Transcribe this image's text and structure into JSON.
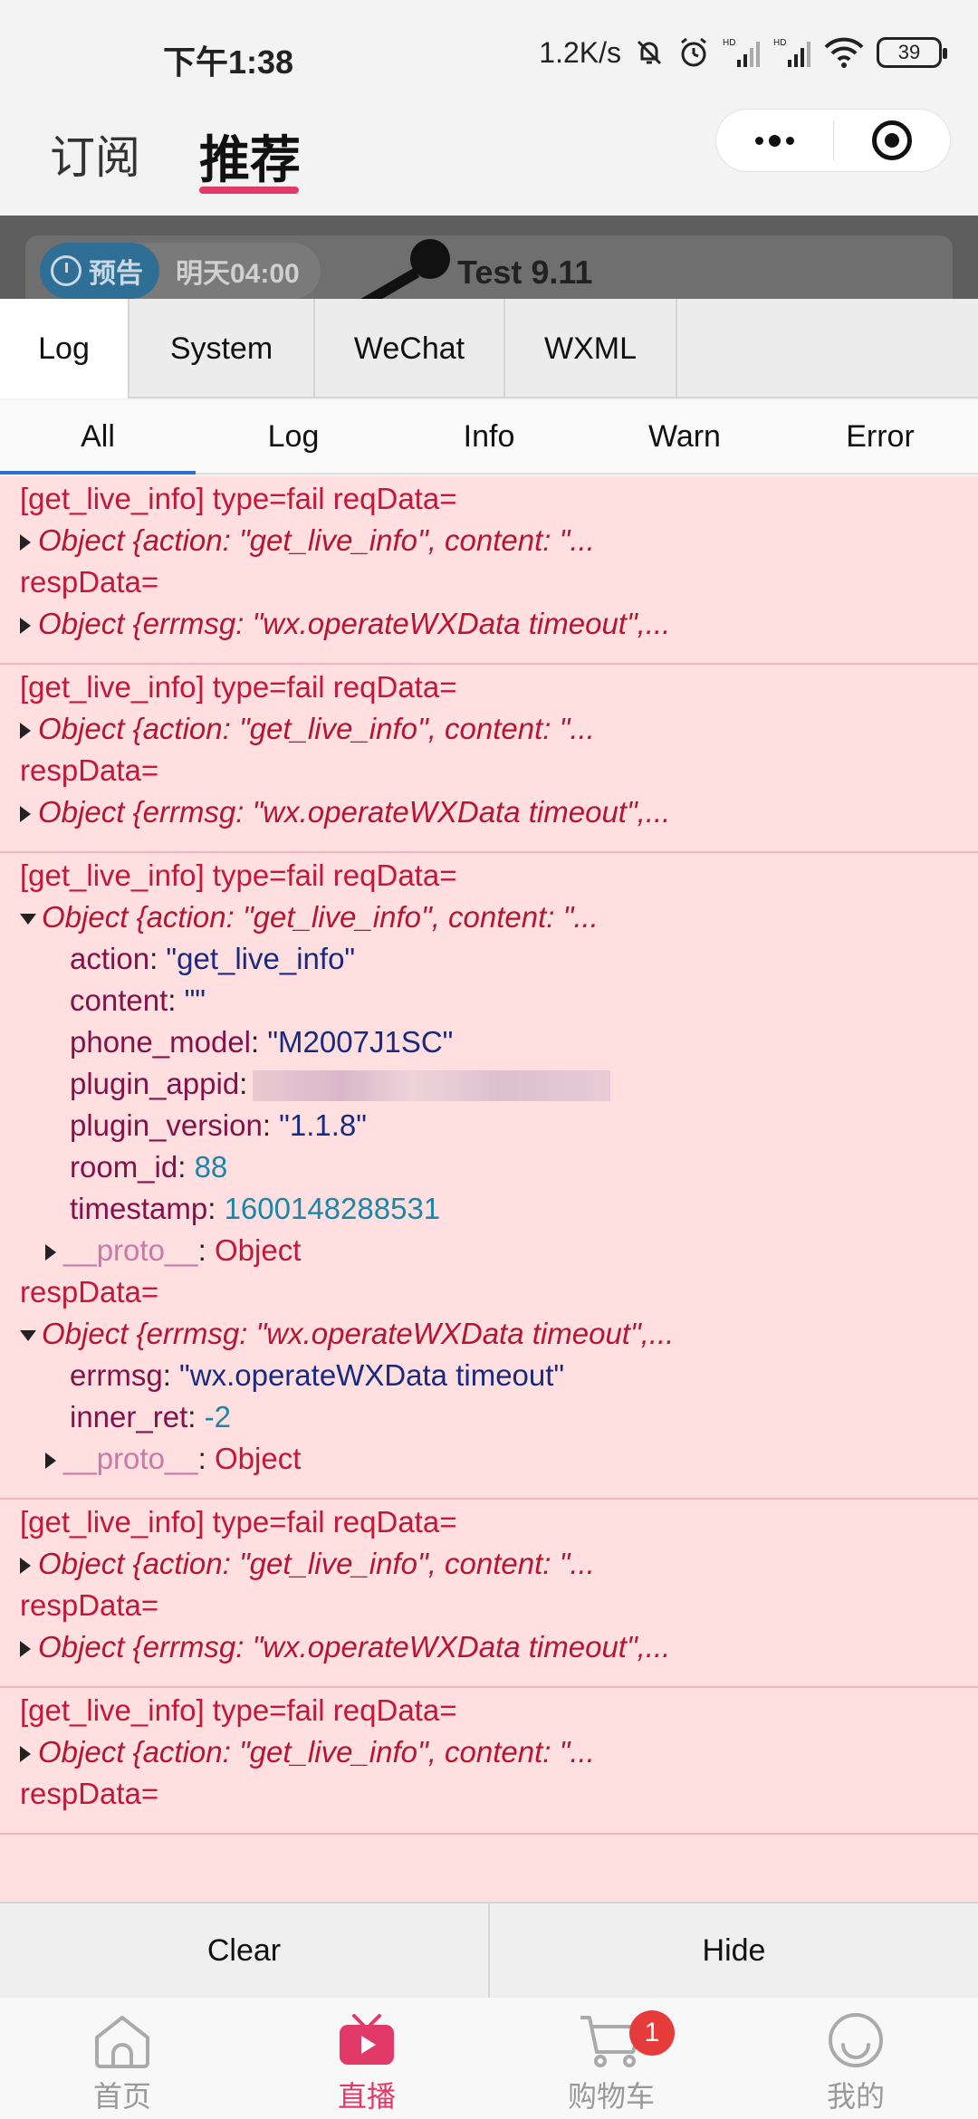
{
  "status_bar": {
    "time": "下午1:38",
    "speed": "1.2K/s",
    "battery": "39",
    "hd1": "HD",
    "hd2": "HD"
  },
  "top_nav": {
    "tab_subscribe": "订阅",
    "tab_recommend": "推荐"
  },
  "live_card": {
    "badge_label": "预告",
    "badge_time": "明天04:00",
    "title": "Test 9.11"
  },
  "vconsole": {
    "tabs": [
      "Log",
      "System",
      "WeChat",
      "WXML"
    ],
    "subtabs": [
      "All",
      "Log",
      "Info",
      "Warn",
      "Error"
    ],
    "entries": [
      {
        "head": "[get_live_info] type=fail reqData=",
        "req_summary": "Object {action: \"get_live_info\", content: \"...",
        "resp_label": "respData=",
        "resp_summary": "Object {errmsg: \"wx.operateWXData timeout\",..."
      },
      {
        "head": "[get_live_info] type=fail reqData=",
        "req_summary": "Object {action: \"get_live_info\", content: \"...",
        "resp_label": "respData=",
        "resp_summary": "Object {errmsg: \"wx.operateWXData timeout\",..."
      },
      {
        "head": "[get_live_info] type=fail reqData=",
        "req_summary": "Object {action: \"get_live_info\", content: \"...",
        "req_props": [
          {
            "key": "action",
            "value": "\"get_live_info\"",
            "kind": "str"
          },
          {
            "key": "content",
            "value": "\"\"",
            "kind": "str"
          },
          {
            "key": "phone_model",
            "value": "\"M2007J1SC\"",
            "kind": "str"
          },
          {
            "key": "plugin_appid",
            "value": "",
            "kind": "blur"
          },
          {
            "key": "plugin_version",
            "value": "\"1.1.8\"",
            "kind": "str"
          },
          {
            "key": "room_id",
            "value": "88",
            "kind": "num"
          },
          {
            "key": "timestamp",
            "value": "1600148288531",
            "kind": "num"
          }
        ],
        "proto_label": "__proto__",
        "proto_value": "Object",
        "resp_label": "respData=",
        "resp_summary": "Object {errmsg: \"wx.operateWXData timeout\",...",
        "resp_props": [
          {
            "key": "errmsg",
            "value": "\"wx.operateWXData timeout\"",
            "kind": "str"
          },
          {
            "key": "inner_ret",
            "value": "-2",
            "kind": "num"
          }
        ]
      },
      {
        "head": "[get_live_info] type=fail reqData=",
        "req_summary": "Object {action: \"get_live_info\", content: \"...",
        "resp_label": "respData=",
        "resp_summary": "Object {errmsg: \"wx.operateWXData timeout\",..."
      },
      {
        "head": "[get_live_info] type=fail reqData=",
        "req_summary": "Object {action: \"get_live_info\", content: \"...",
        "resp_label": "respData="
      }
    ],
    "clear_label": "Clear",
    "hide_label": "Hide"
  },
  "bottom_nav": {
    "items": [
      {
        "label": "首页",
        "icon": "home-icon"
      },
      {
        "label": "直播",
        "icon": "tv-icon"
      },
      {
        "label": "购物车",
        "icon": "cart-icon",
        "badge": "1"
      },
      {
        "label": "我的",
        "icon": "smile-icon"
      }
    ]
  },
  "colors": {
    "accent": "#e23a68",
    "log_error_bg": "#ffdfdf",
    "log_error_text": "#c2183a",
    "tab_indicator": "#2c6fd1"
  }
}
